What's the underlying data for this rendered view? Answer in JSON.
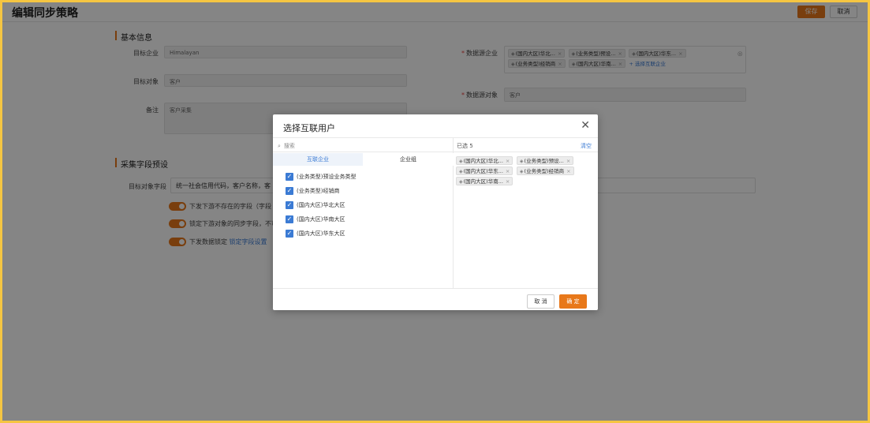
{
  "header": {
    "title": "编辑同步策略",
    "save_label": "保存",
    "cancel_label": "取消"
  },
  "basic": {
    "section_title": "基本信息",
    "target_company_label": "目标企业",
    "target_company_value": "Himalayan",
    "target_object_label": "目标对象",
    "target_object_value": "客户",
    "remark_label": "备注",
    "remark_value": "客户采集",
    "source_company_label": "数据源企业",
    "source_tags": [
      "(国内大区)华北...",
      "(业务类型)预设...",
      "(国内大区)华东...",
      "(业务类型)经销商",
      "(国内大区)华南..."
    ],
    "add_source_link": "+ 选择互联企业",
    "source_object_label": "数据源对象",
    "source_object_value": "客户"
  },
  "preset": {
    "section_title": "采集字段预设",
    "field_label": "目标对象字段",
    "field_value": "统一社会信用代码，客户名称，客",
    "toggle1_text": "下发下游不存在的字段（字段",
    "toggle2_text": "锁定下游对象的同步字段，不可",
    "toggle3_text": "下发数据锁定",
    "toggle3_link": "锁定字段设置"
  },
  "modal": {
    "title": "选择互联用户",
    "search_placeholder": "搜索",
    "tab_company": "互联企业",
    "tab_group": "企业组",
    "items": [
      "(业务类型)预设业务类型",
      "(业务类型)经销商",
      "(国内大区)华北大区",
      "(国内大区)华南大区",
      "(国内大区)华东大区"
    ],
    "selected_label": "已选 5",
    "clear_label": "清空",
    "selected_tags": [
      "(国内大区)华北...",
      "(业务类型)预设...",
      "(国内大区)华东...",
      "(业务类型)经销商",
      "(国内大区)华南..."
    ],
    "cancel_label": "取 消",
    "ok_label": "确 定"
  },
  "colors": {
    "accent": "#e8781a",
    "link": "#3b7bd4",
    "frame": "#f5c542"
  }
}
